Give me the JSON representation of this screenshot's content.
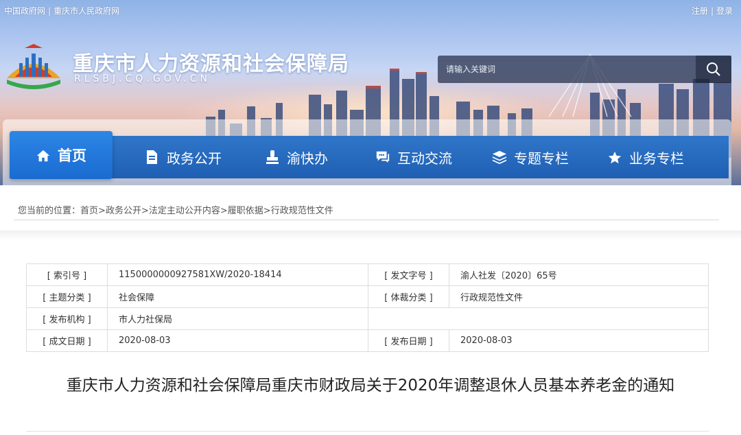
{
  "top_links": {
    "gov_cn": "中国政府网",
    "separator": "|",
    "cq_gov": "重庆市人民政府网"
  },
  "user_links": {
    "register": "注册",
    "separator": "|",
    "login": "登录"
  },
  "site": {
    "title": "重庆市人力资源和社会保障局",
    "domain": "RLSBJ.CQ.GOV.CN"
  },
  "search": {
    "placeholder": "请输入关键词"
  },
  "nav": {
    "items": [
      {
        "label": "首页",
        "icon": "home-icon"
      },
      {
        "label": "政务公开",
        "icon": "document-icon"
      },
      {
        "label": "渝快办",
        "icon": "stamp-icon"
      },
      {
        "label": "互动交流",
        "icon": "chat-icon"
      },
      {
        "label": "专题专栏",
        "icon": "layers-icon"
      },
      {
        "label": "业务专栏",
        "icon": "star-icon"
      }
    ]
  },
  "breadcrumb": {
    "prefix": "您当前的位置：",
    "items": [
      "首页",
      "政务公开",
      "法定主动公开内容",
      "履职依据",
      "行政规范性文件"
    ],
    "separator": ">"
  },
  "info_table": {
    "index_label": "[ 索引号 ]",
    "index_value": "1150000000927581XW/2020-18414",
    "docno_label": "[ 发文字号 ]",
    "docno_value": "渝人社发〔2020〕65号",
    "subject_label": "[ 主题分类 ]",
    "subject_value": "社会保障",
    "genre_label": "[ 体裁分类 ]",
    "genre_value": "行政规范性文件",
    "issuer_label": "[ 发布机构 ]",
    "issuer_value": "市人力社保局",
    "created_label": "[ 成文日期 ]",
    "created_value": "2020-08-03",
    "published_label": "[ 发布日期 ]",
    "published_value": "2020-08-03"
  },
  "article": {
    "title": "重庆市人力资源和社会保障局重庆市财政局关于2020年调整退休人员基本养老金的通知"
  },
  "colors": {
    "nav_blue": "#1f5fb3",
    "nav_active": "#1a6bd0",
    "banner_sky": "#a9c3ef"
  }
}
